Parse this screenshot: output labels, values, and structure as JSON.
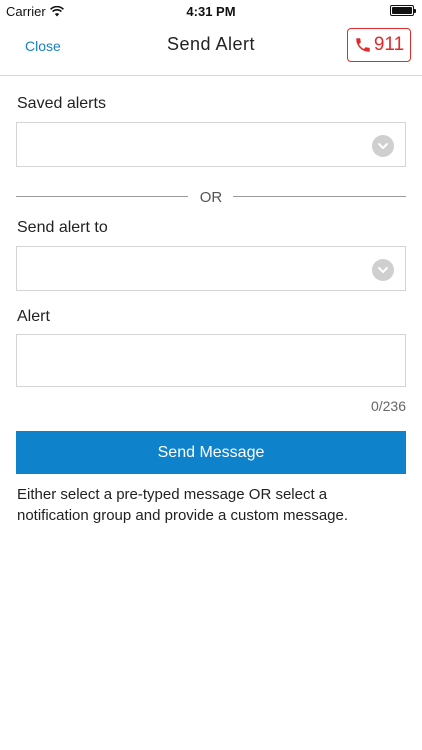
{
  "status_bar": {
    "carrier": "Carrier",
    "time": "4:31 PM"
  },
  "nav": {
    "close_label": "Close",
    "title": "Send Alert",
    "emergency_label": "911",
    "emergency_color": "#e12a2a",
    "link_color": "#1a80c4"
  },
  "form": {
    "saved_alerts_label": "Saved alerts",
    "saved_alerts_value": "",
    "or_label": "OR",
    "send_to_label": "Send alert to",
    "send_to_value": "",
    "alert_label": "Alert",
    "alert_value": "",
    "char_counter": "0/236",
    "send_button_label": "Send Message",
    "send_button_color": "#0f82cc",
    "help_text": "Either select a pre-typed message OR select a notification group and provide a custom message."
  },
  "icons": {
    "wifi": "wifi-icon",
    "battery": "battery-icon",
    "phone": "phone-icon",
    "dropdown": "chevron-down-icon"
  }
}
